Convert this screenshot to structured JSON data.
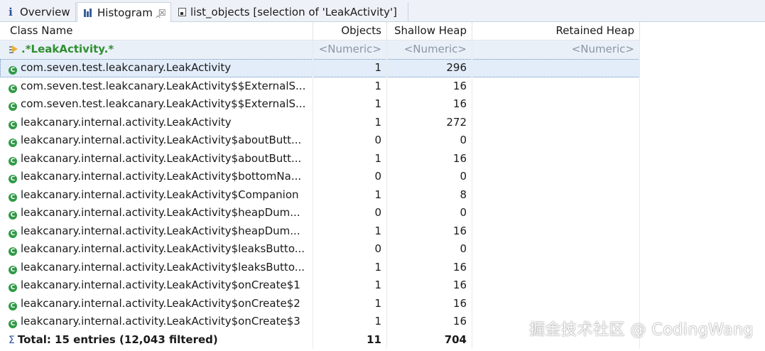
{
  "tabs": [
    {
      "label": "Overview",
      "icon": "info-icon",
      "active": false
    },
    {
      "label": "Histogram",
      "icon": "histogram-icon",
      "active": true,
      "close": "☒"
    },
    {
      "label": "list_objects  [selection of 'LeakActivity']",
      "icon": "list-objects-icon",
      "active": false
    }
  ],
  "columns": {
    "class_name": "Class Name",
    "objects": "Objects",
    "shallow_heap": "Shallow Heap",
    "retained_heap": "Retained Heap"
  },
  "filter": {
    "class_name": ".*LeakActivity.*",
    "objects": "<Numeric>",
    "shallow_heap": "<Numeric>",
    "retained_heap": "<Numeric>"
  },
  "rows": [
    {
      "class_name": "com.seven.test.leakcanary.LeakActivity",
      "objects": "1",
      "shallow_heap": "296",
      "retained_heap": ""
    },
    {
      "class_name": "com.seven.test.leakcanary.LeakActivity$$ExternalS...",
      "objects": "1",
      "shallow_heap": "16",
      "retained_heap": ""
    },
    {
      "class_name": "com.seven.test.leakcanary.LeakActivity$$ExternalS...",
      "objects": "1",
      "shallow_heap": "16",
      "retained_heap": ""
    },
    {
      "class_name": "leakcanary.internal.activity.LeakActivity",
      "objects": "1",
      "shallow_heap": "272",
      "retained_heap": ""
    },
    {
      "class_name": "leakcanary.internal.activity.LeakActivity$aboutButt...",
      "objects": "0",
      "shallow_heap": "0",
      "retained_heap": ""
    },
    {
      "class_name": "leakcanary.internal.activity.LeakActivity$aboutButt...",
      "objects": "1",
      "shallow_heap": "16",
      "retained_heap": ""
    },
    {
      "class_name": "leakcanary.internal.activity.LeakActivity$bottomNa...",
      "objects": "0",
      "shallow_heap": "0",
      "retained_heap": ""
    },
    {
      "class_name": "leakcanary.internal.activity.LeakActivity$Companion",
      "objects": "1",
      "shallow_heap": "8",
      "retained_heap": ""
    },
    {
      "class_name": "leakcanary.internal.activity.LeakActivity$heapDum...",
      "objects": "0",
      "shallow_heap": "0",
      "retained_heap": ""
    },
    {
      "class_name": "leakcanary.internal.activity.LeakActivity$heapDum...",
      "objects": "1",
      "shallow_heap": "16",
      "retained_heap": ""
    },
    {
      "class_name": "leakcanary.internal.activity.LeakActivity$leaksButto...",
      "objects": "0",
      "shallow_heap": "0",
      "retained_heap": ""
    },
    {
      "class_name": "leakcanary.internal.activity.LeakActivity$leaksButto...",
      "objects": "1",
      "shallow_heap": "16",
      "retained_heap": ""
    },
    {
      "class_name": "leakcanary.internal.activity.LeakActivity$onCreate$1",
      "objects": "1",
      "shallow_heap": "16",
      "retained_heap": ""
    },
    {
      "class_name": "leakcanary.internal.activity.LeakActivity$onCreate$2",
      "objects": "1",
      "shallow_heap": "16",
      "retained_heap": ""
    },
    {
      "class_name": "leakcanary.internal.activity.LeakActivity$onCreate$3",
      "objects": "1",
      "shallow_heap": "16",
      "retained_heap": ""
    }
  ],
  "total": {
    "label": "Total: 15 entries (12,043 filtered)",
    "objects": "11",
    "shallow_heap": "704",
    "retained_heap": ""
  },
  "class_icon_glyph": "C",
  "sum_glyph": "Σ",
  "watermark": "掘金技术社区 @ CodingWang",
  "colors": {
    "filter_text": "#2f8f2f",
    "class_icon": "#2f9a46",
    "selected_row": "#e2edf9",
    "filter_row": "#eaf0f8"
  }
}
